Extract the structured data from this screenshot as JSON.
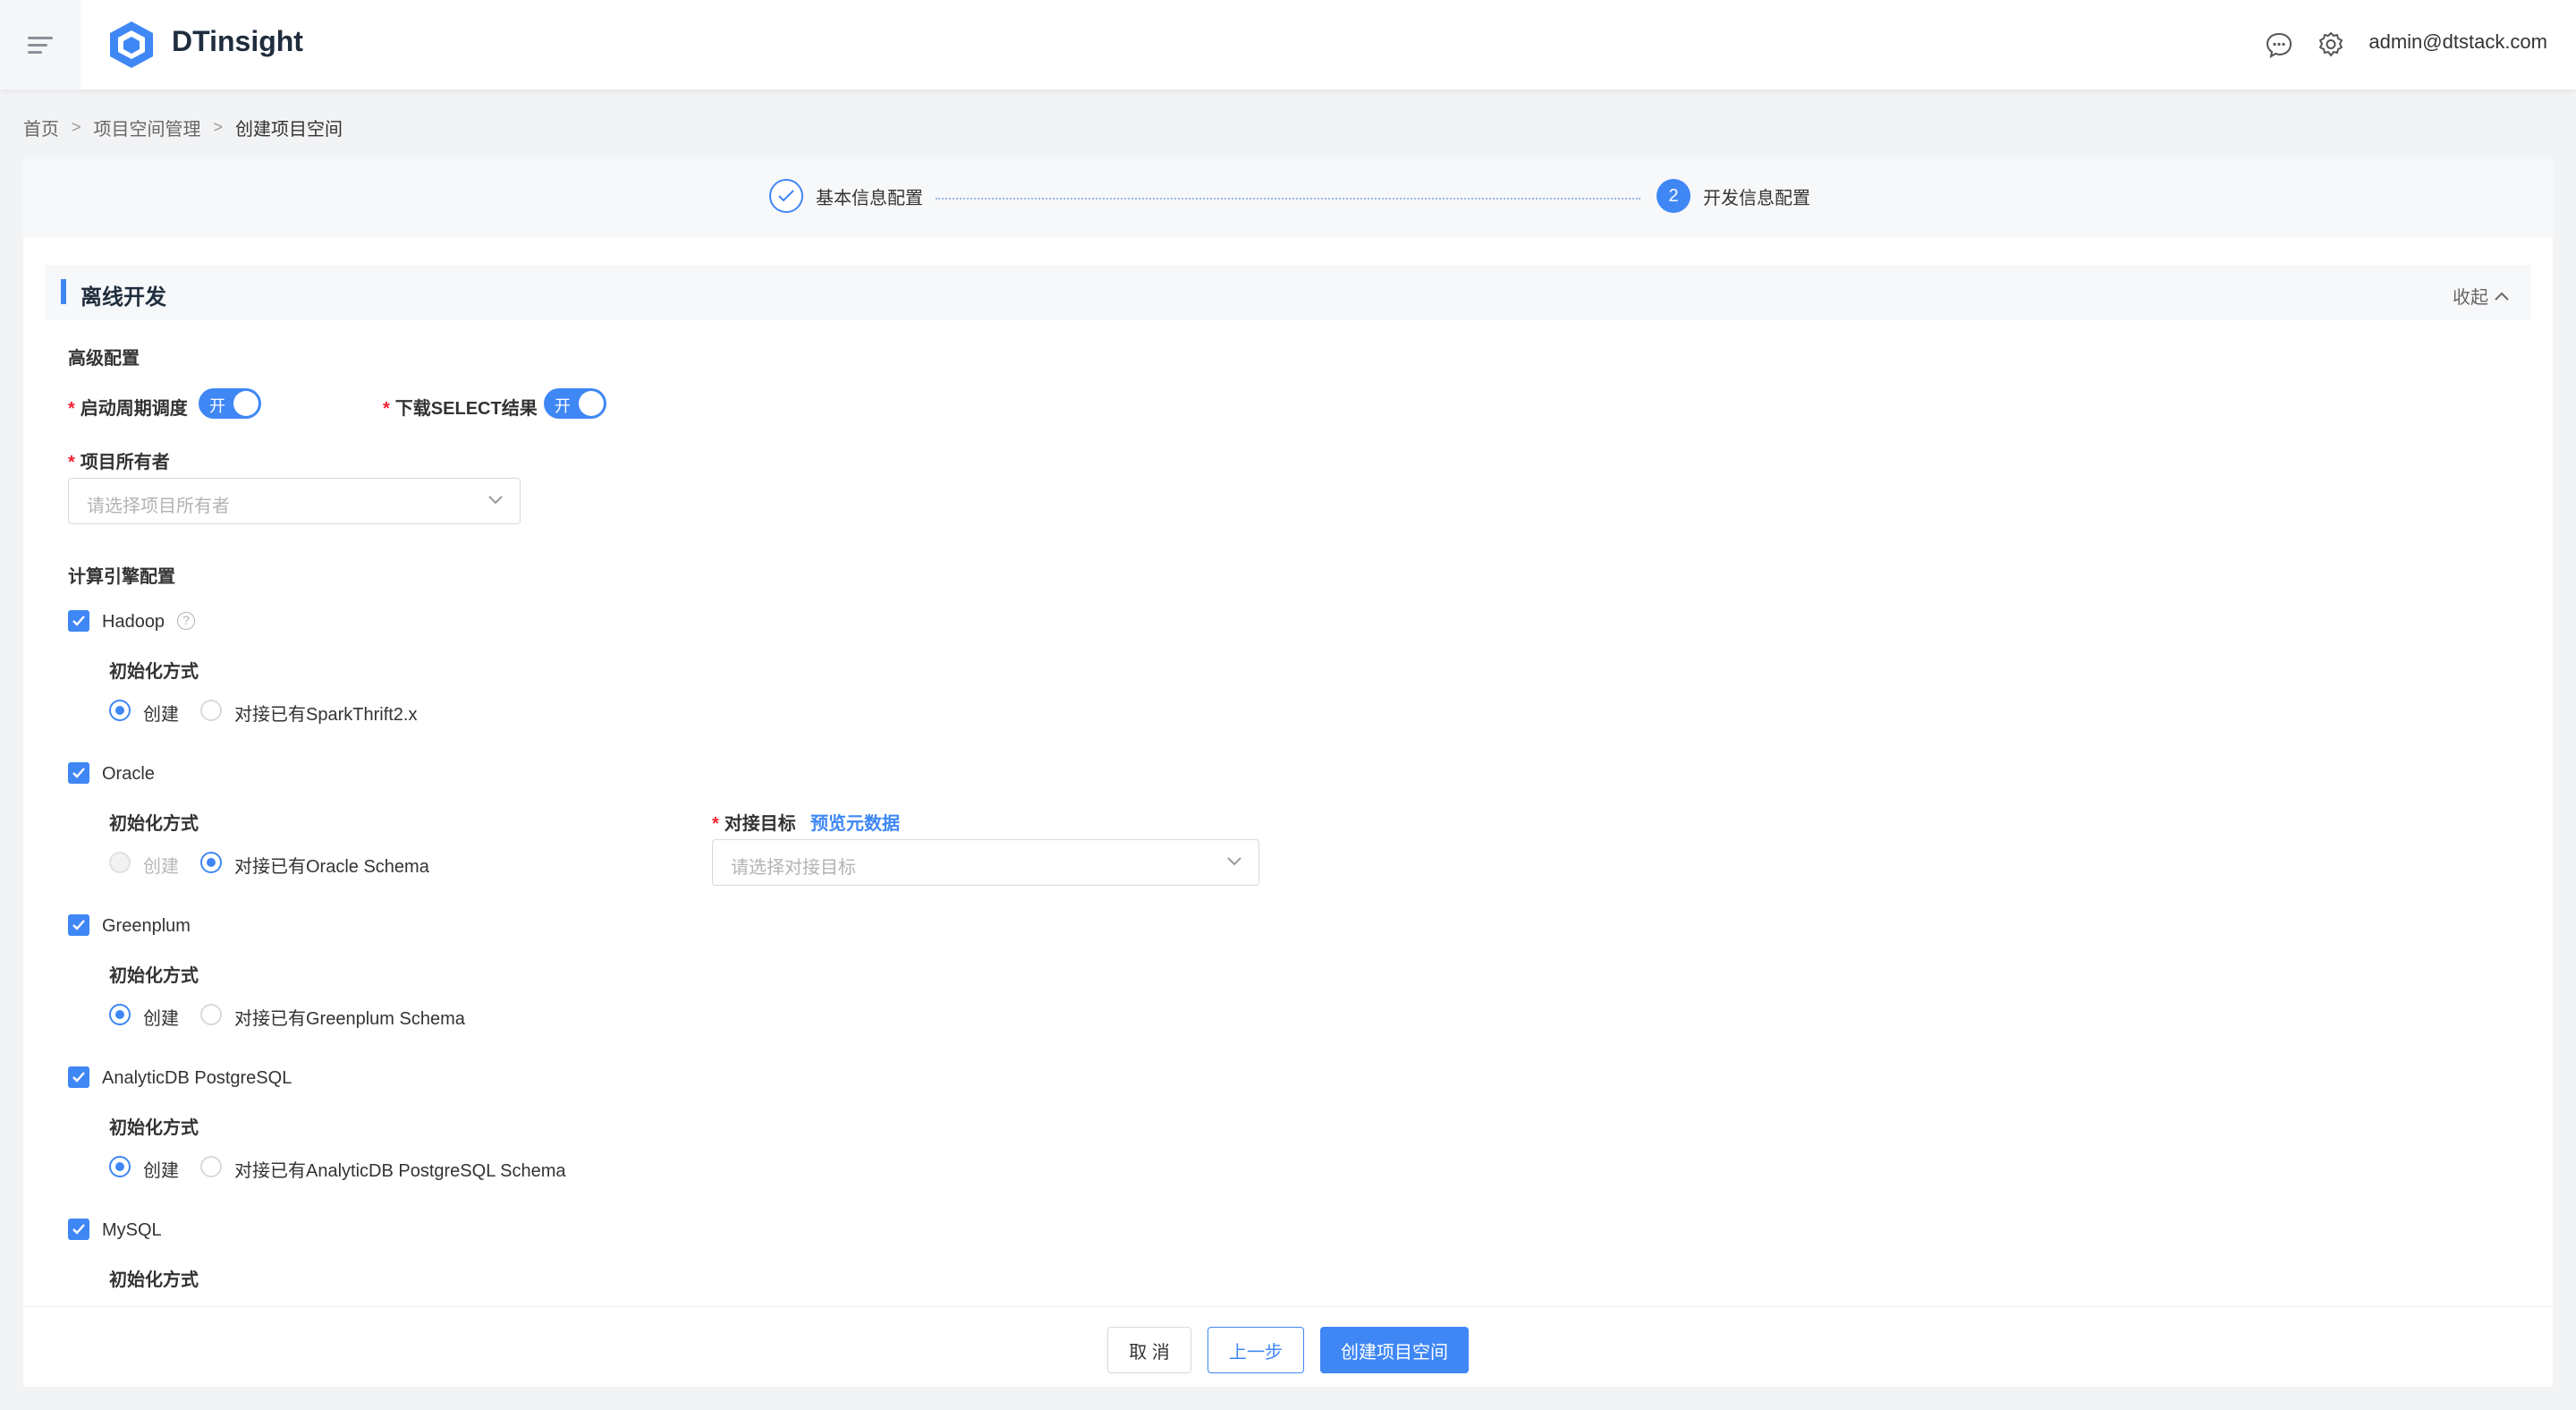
{
  "header": {
    "brand": "DTinsight",
    "user_email": "admin@dtstack.com"
  },
  "breadcrumb": [
    "首页",
    "项目空间管理",
    "创建项目空间"
  ],
  "steps": [
    {
      "label": "基本信息配置",
      "status": "done"
    },
    {
      "label": "开发信息配置",
      "status": "active",
      "number": "2"
    }
  ],
  "section": {
    "title": "离线开发",
    "collapse_label": "收起"
  },
  "advanced": {
    "title": "高级配置",
    "schedule_label": "启动周期调度",
    "schedule_switch": "开",
    "download_label": "下载SELECT结果",
    "download_switch": "开",
    "owner_label": "项目所有者",
    "owner_placeholder": "请选择项目所有者"
  },
  "engines": {
    "title": "计算引擎配置",
    "init_label": "初始化方式",
    "create_label": "创建",
    "hadoop": {
      "name": "Hadoop",
      "existing": "对接已有SparkThrift2.x",
      "help": "?"
    },
    "oracle": {
      "name": "Oracle",
      "existing": "对接已有Oracle Schema",
      "target_label": "对接目标",
      "preview_link": "预览元数据",
      "target_placeholder": "请选择对接目标"
    },
    "greenplum": {
      "name": "Greenplum",
      "existing": "对接已有Greenplum Schema"
    },
    "adb": {
      "name": "AnalyticDB PostgreSQL",
      "existing": "对接已有AnalyticDB PostgreSQL Schema"
    },
    "mysql": {
      "name": "MySQL"
    }
  },
  "footer": {
    "cancel": "取 消",
    "prev": "上一步",
    "create": "创建项目空间"
  },
  "colors": {
    "accent": "#3f87f5",
    "required": "#f5222d"
  }
}
